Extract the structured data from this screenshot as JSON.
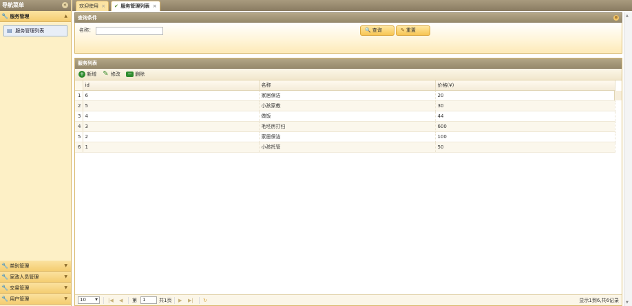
{
  "nav": {
    "title": "导航菜单",
    "collapse_icon": "double-chevron-left-icon",
    "groups_open": [
      {
        "label": "服务管理"
      }
    ],
    "open_items": [
      {
        "label": "服务管理列表"
      }
    ],
    "groups_closed": [
      {
        "label": "类别管理"
      },
      {
        "label": "家政人员管理"
      },
      {
        "label": "交易管理"
      },
      {
        "label": "用户管理"
      }
    ]
  },
  "tabs": [
    {
      "label": "欢迎使用",
      "active": false
    },
    {
      "label": "服务管理列表",
      "active": true
    }
  ],
  "query": {
    "title": "查询条件",
    "name_label": "名称：",
    "name_value": "",
    "search_label": "查询",
    "reset_label": "重置"
  },
  "list": {
    "title": "服务列表",
    "toolbar": {
      "add": "新增",
      "edit": "修改",
      "delete": "删除"
    },
    "columns": [
      "id",
      "名称",
      "价格(¥)"
    ],
    "rows": [
      {
        "n": "1",
        "id": "6",
        "name": "家居保洁",
        "price": "20"
      },
      {
        "n": "2",
        "id": "5",
        "name": "小孩家教",
        "price": "30"
      },
      {
        "n": "3",
        "id": "4",
        "name": "做饭",
        "price": "44"
      },
      {
        "n": "4",
        "id": "3",
        "name": "毛坯房打扫",
        "price": "600"
      },
      {
        "n": "5",
        "id": "2",
        "name": "家居保洁",
        "price": "100"
      },
      {
        "n": "6",
        "id": "1",
        "name": "小孩托管",
        "price": "50"
      }
    ]
  },
  "pager": {
    "page_size": "10",
    "page_prefix": "第",
    "page_value": "1",
    "page_suffix": "共1页",
    "info": "显示1到6,共6记录"
  },
  "colors": {
    "accent": "#f7c553",
    "header": "#978a6c",
    "nav_bg": "#fdf0c6"
  }
}
